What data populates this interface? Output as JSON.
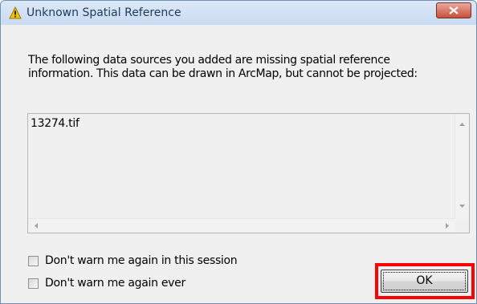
{
  "window": {
    "title": "Unknown Spatial Reference",
    "title_icon": "warning-icon",
    "close_icon": "close-icon"
  },
  "message": "The following data sources you added are missing spatial reference\ninformation. This data can be drawn in ArcMap, but cannot be projected:",
  "data_sources": {
    "items": [
      "13274.tif"
    ]
  },
  "options": {
    "session_label": "Don't warn me again in this session",
    "session_checked": false,
    "ever_label": "Don't warn me again ever",
    "ever_checked": false
  },
  "buttons": {
    "ok_label": "OK"
  },
  "colors": {
    "highlight": "#ff0000",
    "close_button": "#c7503b"
  }
}
